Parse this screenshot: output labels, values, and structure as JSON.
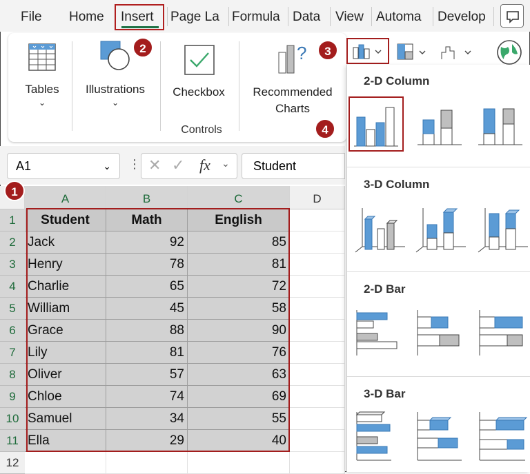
{
  "tabs": {
    "file": "File",
    "home": "Home",
    "insert": "Insert",
    "page_layout": "Page La",
    "formulas": "Formula",
    "data": "Data",
    "view": "View",
    "automate": "Automa",
    "developer": "Develop"
  },
  "ribbon": {
    "tables": "Tables",
    "illustrations": "Illustrations",
    "checkbox": "Checkbox",
    "controls_group": "Controls",
    "recommended_line1": "Recommended",
    "recommended_line2": "Charts"
  },
  "badges": {
    "b1": "1",
    "b2": "2",
    "b3": "3",
    "b4": "4"
  },
  "formula_bar": {
    "name_box": "A1",
    "fx": "fx",
    "content": "Student"
  },
  "columns": [
    "A",
    "B",
    "C",
    "D"
  ],
  "row_numbers": [
    "1",
    "2",
    "3",
    "4",
    "5",
    "6",
    "7",
    "8",
    "9",
    "10",
    "11",
    "12"
  ],
  "table": {
    "headers": [
      "Student",
      "Math",
      "English"
    ],
    "rows": [
      [
        "Jack",
        "92",
        "85"
      ],
      [
        "Henry",
        "78",
        "81"
      ],
      [
        "Charlie",
        "65",
        "72"
      ],
      [
        "William",
        "45",
        "58"
      ],
      [
        "Grace",
        "88",
        "90"
      ],
      [
        "Lily",
        "81",
        "76"
      ],
      [
        "Oliver",
        "57",
        "63"
      ],
      [
        "Chloe",
        "74",
        "69"
      ],
      [
        "Samuel",
        "34",
        "55"
      ],
      [
        "Ella",
        "29",
        "40"
      ]
    ]
  },
  "dropdown": {
    "sections": [
      "2-D Column",
      "3-D Column",
      "2-D Bar",
      "3-D Bar"
    ]
  },
  "colors": {
    "accent_red": "#a31d1d",
    "excel_green": "#1e7145",
    "chart_blue": "#5b9bd5",
    "chart_gray": "#bfbfbf"
  }
}
